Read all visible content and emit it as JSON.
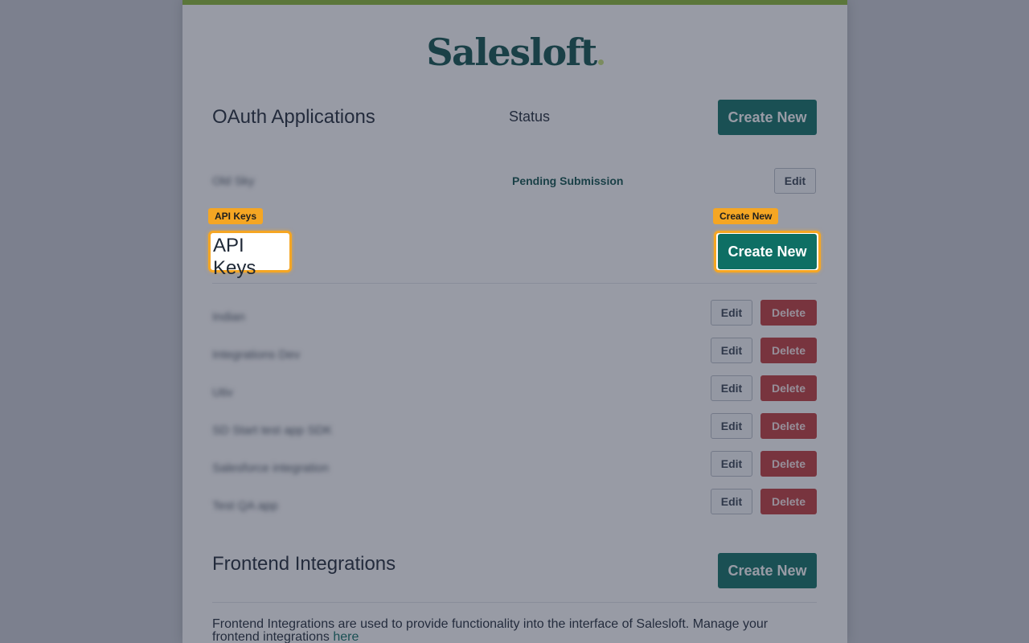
{
  "brand": {
    "logo_text": "Salesloft",
    "accent_color": "#8ab833",
    "primary_color": "#0e6f64"
  },
  "oauth": {
    "title": "OAuth Applications",
    "status_header": "Status",
    "create_label": "Create New",
    "apps": [
      {
        "name": "Old Sky",
        "status": "Pending Submission",
        "edit_label": "Edit"
      }
    ]
  },
  "api_keys": {
    "title": "API Keys",
    "create_label": "Create New",
    "keys": [
      {
        "name": "Indian",
        "edit_label": "Edit",
        "delete_label": "Delete"
      },
      {
        "name": "Integrations Dev",
        "edit_label": "Edit",
        "delete_label": "Delete"
      },
      {
        "name": "Utiv",
        "edit_label": "Edit",
        "delete_label": "Delete"
      },
      {
        "name": "SD Start test app SDK",
        "edit_label": "Edit",
        "delete_label": "Delete"
      },
      {
        "name": "Salesforce integration",
        "edit_label": "Edit",
        "delete_label": "Delete"
      },
      {
        "name": "Test QA app",
        "edit_label": "Edit",
        "delete_label": "Delete"
      }
    ]
  },
  "frontend": {
    "title": "Frontend Integrations",
    "create_label": "Create New",
    "description": "Frontend Integrations are used to provide functionality into the interface of Salesloft. Manage your frontend integrations",
    "link_text": "here"
  },
  "highlights": {
    "title_tag": "API Keys",
    "button_tag": "Create New"
  }
}
